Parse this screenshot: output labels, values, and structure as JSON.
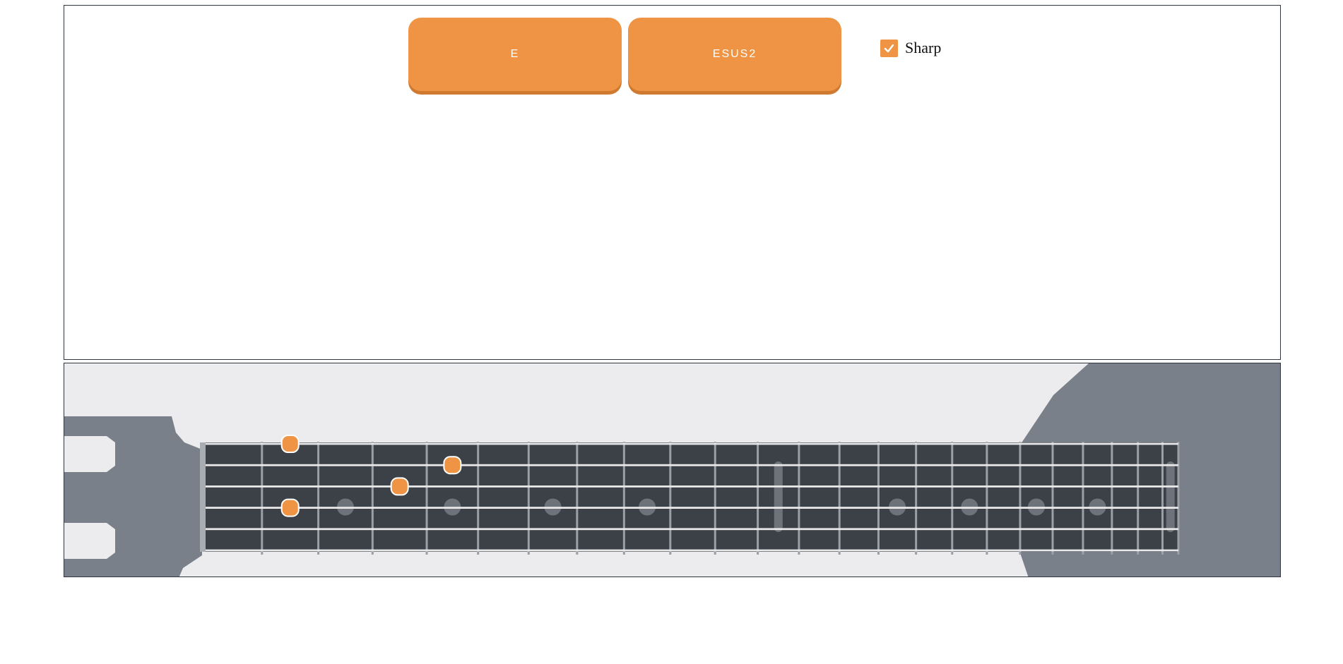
{
  "controls": {
    "root_label": "E",
    "chord_label": "ESUS2",
    "sharp_label": "Sharp",
    "sharp_checked": true
  },
  "colors": {
    "accent": "#ee9444",
    "accent_shadow": "#d07a30",
    "fretboard": "#3c4047",
    "headstock": "#7a808a",
    "panel_bg": "#ececee",
    "fret_wire": "#9aa0a8",
    "string": "#e8e8e8",
    "inlay": "#6e737b"
  },
  "fretboard": {
    "strings": 6,
    "frets": 21,
    "single_inlay_frets": [
      3,
      5,
      7,
      9,
      15,
      17,
      19,
      21
    ],
    "double_inlay_frets": [
      12,
      24
    ],
    "highlighted_notes": [
      {
        "string": 1,
        "fret": 2
      },
      {
        "string": 2,
        "fret": 5
      },
      {
        "string": 3,
        "fret": 4
      },
      {
        "string": 4,
        "fret": 2
      }
    ]
  }
}
